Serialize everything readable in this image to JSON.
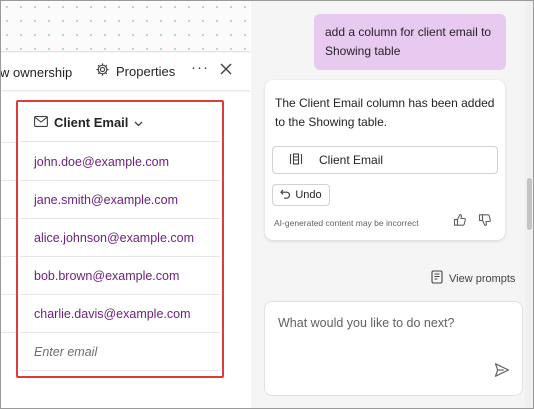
{
  "toolbar": {
    "ownership_label": "w ownership",
    "properties_label": "Properties",
    "more_label": "···"
  },
  "table": {
    "column_header": "Client Email",
    "rows": [
      "john.doe@example.com",
      "jane.smith@example.com",
      "alice.johnson@example.com",
      "bob.brown@example.com",
      "charlie.davis@example.com"
    ],
    "new_row_placeholder": "Enter email"
  },
  "chat": {
    "user_message": "add a column for client email to Showing table",
    "ai_response": "The Client Email column has been added to the Showing table.",
    "column_chip_label": "Client Email",
    "undo_label": "Undo",
    "disclaimer": "AI-generated content may be incorrect",
    "view_prompts_label": "View prompts",
    "input_placeholder": "What would you like to do next?"
  },
  "colors": {
    "user_bubble": "#e8c9f0",
    "email_text": "#6b1f7c",
    "highlight_border": "#e03a3a"
  },
  "icons": [
    "gear-icon",
    "close-icon",
    "mail-icon",
    "chevron-down-icon",
    "column-icon",
    "undo-icon",
    "thumbs-up-icon",
    "thumbs-down-icon",
    "prompts-icon",
    "send-icon"
  ]
}
